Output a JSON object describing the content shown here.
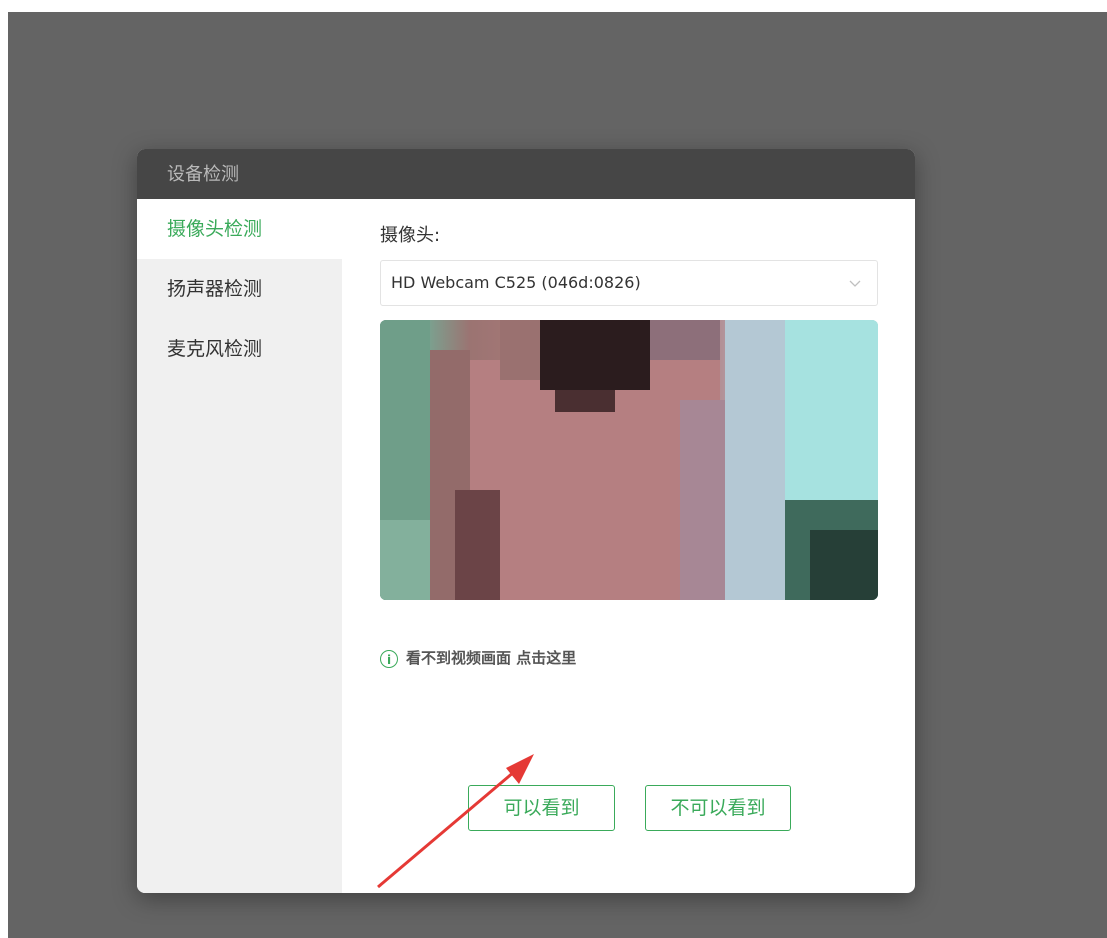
{
  "dialog": {
    "title": "设备检测"
  },
  "sidebar": {
    "items": [
      {
        "label": "摄像头检测",
        "active": true
      },
      {
        "label": "扬声器检测",
        "active": false
      },
      {
        "label": "麦克风检测",
        "active": false
      }
    ]
  },
  "camera": {
    "label": "摄像头:",
    "selected_device": "HD Webcam C525 (046d:0826)",
    "preview": "pixelated-webcam-preview"
  },
  "hint": {
    "icon": "info-icon",
    "text": "看不到视频画面 点击这里"
  },
  "buttons": {
    "can_see": "可以看到",
    "cannot_see": "不可以看到"
  },
  "colors": {
    "accent": "#3aaa5a",
    "header_bg": "#464646",
    "overlay": "#646464",
    "annotation_arrow": "#e53935"
  }
}
